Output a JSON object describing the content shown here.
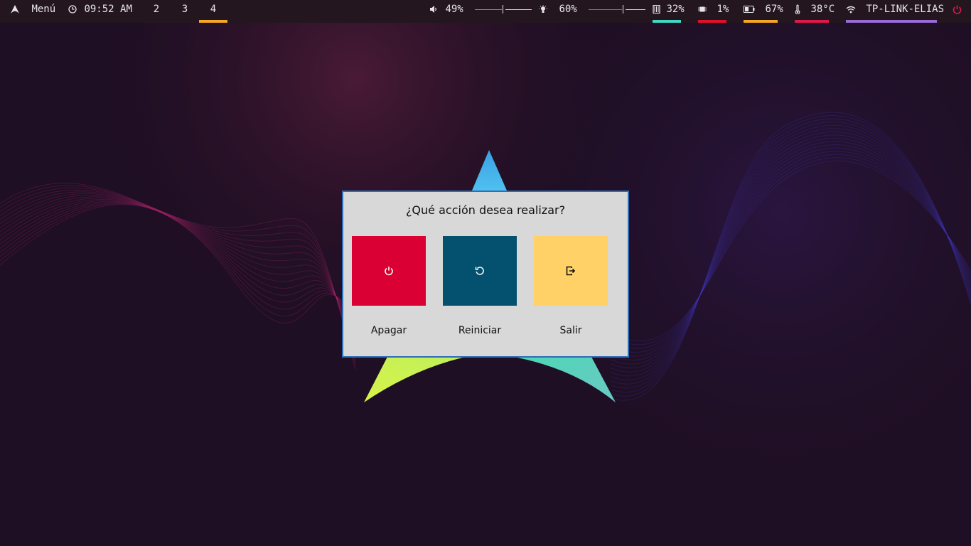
{
  "topbar": {
    "menu": {
      "label": "Menú",
      "icon": "arch-logo-icon"
    },
    "clock": {
      "time": "09:52 AM",
      "icon": "clock-icon"
    },
    "workspaces": [
      {
        "label": "2",
        "active": false
      },
      {
        "label": "3",
        "active": false
      },
      {
        "label": "4",
        "active": true
      }
    ],
    "volume": {
      "label": "49%",
      "level": 0.49,
      "icon": "speaker-icon"
    },
    "brightness": {
      "label": "60%",
      "level": 0.6,
      "icon": "lightbulb-icon"
    },
    "memory": {
      "label": "32%",
      "icon": "memory-icon"
    },
    "cpu": {
      "label": "1%",
      "icon": "cpu-icon"
    },
    "battery": {
      "label": "67%",
      "icon": "battery-icon"
    },
    "temperature": {
      "label": "38°C",
      "icon": "thermometer-icon"
    },
    "network": {
      "label": "TP-LINK-ELIAS",
      "icon": "wifi-icon"
    },
    "power": {
      "icon": "power-icon"
    }
  },
  "colors": {
    "workspace_active": "#f5a623",
    "volume_track": "#4caf50",
    "brightness_track": "#8b5fc4",
    "memory": "#3fd9c3",
    "cpu": "#e0102a",
    "battery": "#f5a623",
    "temperature": "#e0174a",
    "network": "#9a6ad6",
    "power": "#e0174a",
    "shutdown": "#db0033",
    "restart": "#04506f",
    "logout": "#ffd166",
    "dialog_border": "#2f6db6"
  },
  "dialog": {
    "title": "¿Qué acción desea realizar?",
    "buttons": [
      {
        "label": "Apagar",
        "icon": "power-icon"
      },
      {
        "label": "Reiniciar",
        "icon": "restart-icon"
      },
      {
        "label": "Salir",
        "icon": "logout-icon"
      }
    ]
  }
}
